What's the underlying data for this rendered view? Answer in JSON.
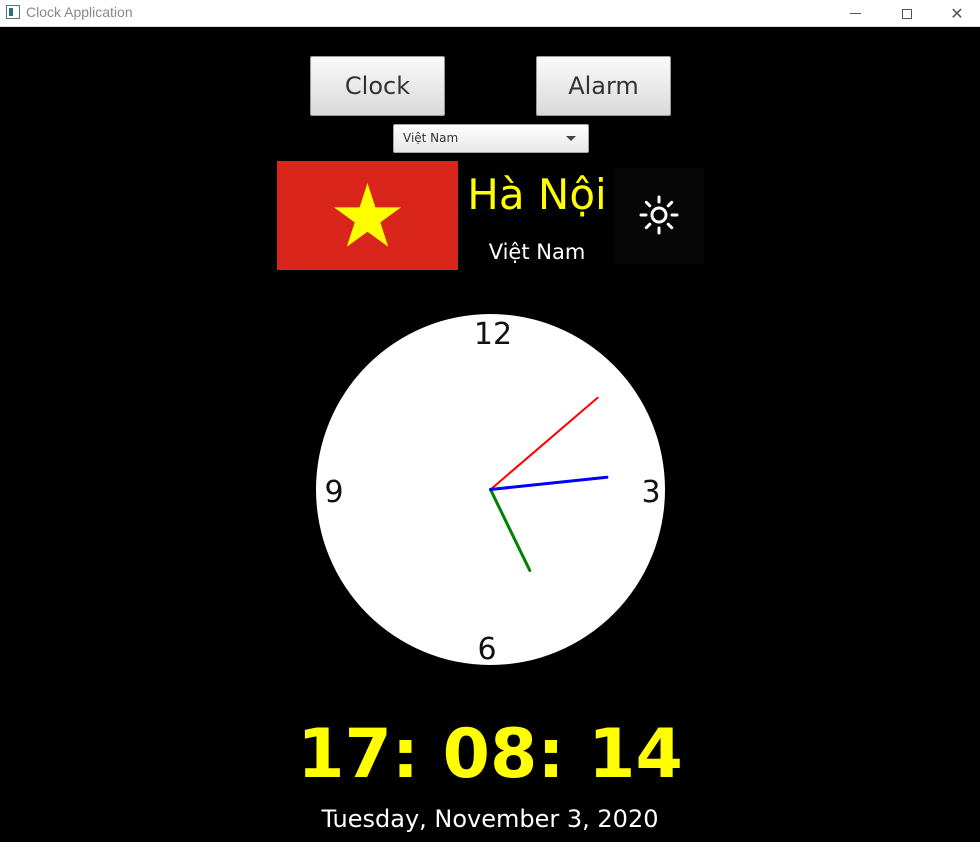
{
  "window": {
    "title": "Clock Application",
    "controls": {
      "minimize": "—",
      "maximize": "□",
      "close": "✕"
    }
  },
  "nav": {
    "clock_label": "Clock",
    "alarm_label": "Alarm"
  },
  "country_select": {
    "selected": "Việt Nam"
  },
  "location": {
    "city": "Hà Nội",
    "country": "Việt Nam",
    "flag_icon": "vietnam-flag-icon",
    "weather_icon": "sun-icon"
  },
  "analog_clock": {
    "numerals": {
      "twelve": "12",
      "three": "3",
      "six": "6",
      "nine": "9"
    },
    "hours": 17,
    "minutes": 8,
    "seconds": 14,
    "hand_colors": {
      "hour": "#008000",
      "minute": "#ff0000",
      "second": "#0000ff"
    }
  },
  "digital": {
    "time": "17: 08: 14",
    "date": "Tuesday, November 3, 2020"
  },
  "colors": {
    "background": "#000000",
    "accent": "#ffff00",
    "flag_red": "#da251d",
    "flag_star": "#ffff00"
  }
}
